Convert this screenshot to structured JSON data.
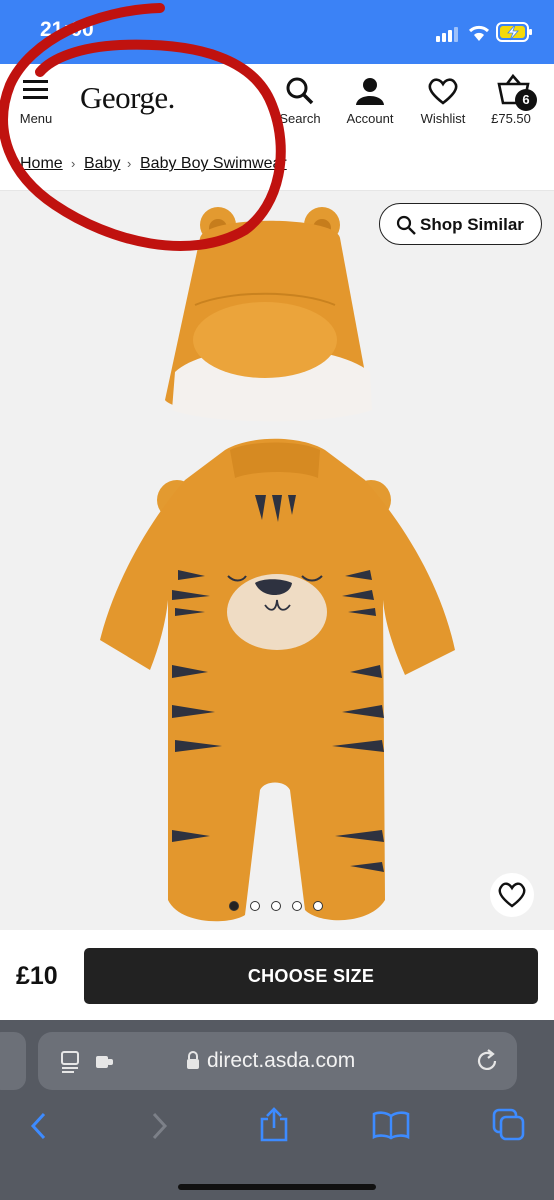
{
  "status_bar": {
    "time": "21:00"
  },
  "header": {
    "menu_label": "Menu",
    "logo_text": "George.",
    "search_label": "Search",
    "account_label": "Account",
    "wishlist_label": "Wishlist",
    "basket_total": "£75.50",
    "basket_count": "6"
  },
  "breadcrumb": [
    "Home",
    "Baby",
    "Baby Boy Swimwear"
  ],
  "product": {
    "shop_similar_label": "Shop Similar",
    "image_count": 5,
    "active_image": 1,
    "price": "£10",
    "choose_size_label": "CHOOSE SIZE"
  },
  "browser": {
    "url": "direct.asda.com"
  },
  "colors": {
    "status_bar": "#3b82f6",
    "annotation_red": "#c0120f",
    "product_orange": "#e3972d"
  }
}
